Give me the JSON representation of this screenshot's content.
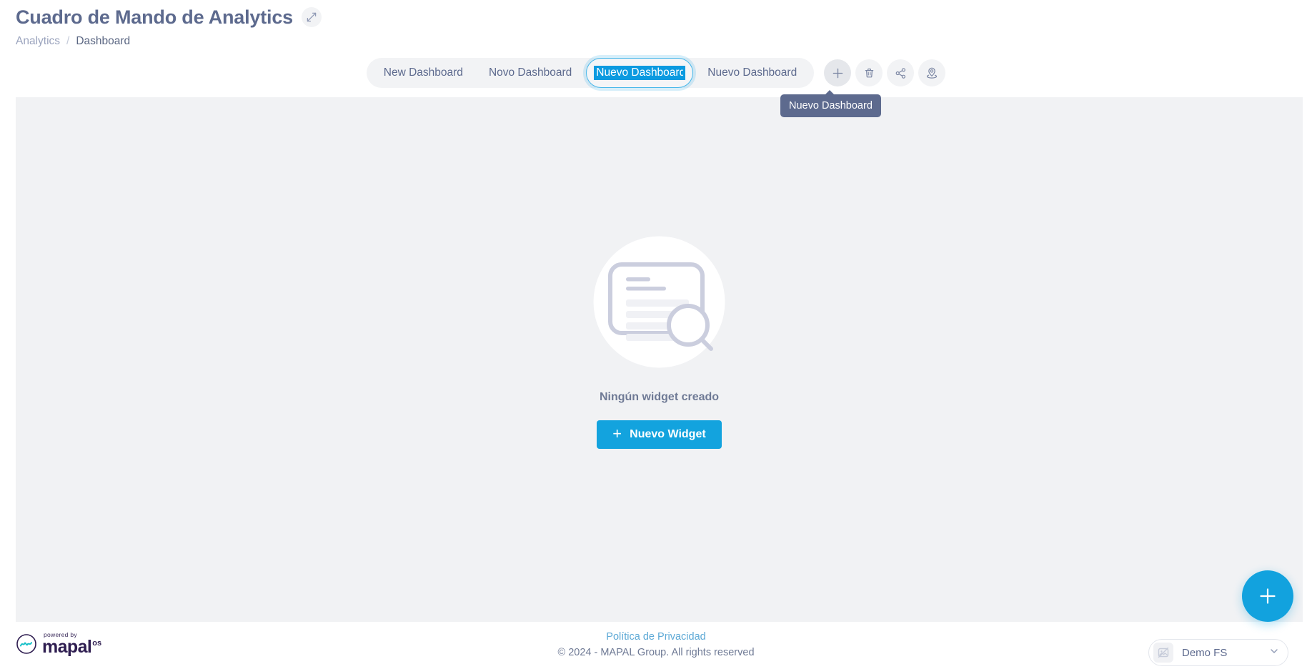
{
  "header": {
    "title": "Cuadro de Mando de Analytics",
    "expand_icon": "expand-arrows-icon",
    "breadcrumb": {
      "parent": "Analytics",
      "separator": "/",
      "current": "Dashboard"
    }
  },
  "tabs": {
    "items": [
      {
        "label": "New Dashboard",
        "state": "idle"
      },
      {
        "label": "Novo Dashboard",
        "state": "idle"
      },
      {
        "label": "Nuevo Dashboard",
        "state": "editing-selected"
      },
      {
        "label": "Nuevo Dashboard",
        "state": "idle"
      }
    ],
    "editing_value": "Nuevo Dashboard",
    "editing_placeholder": "Nuevo Dashboard",
    "actions": [
      {
        "name": "add-dashboard-button",
        "icon": "plus-icon",
        "hovered": true
      },
      {
        "name": "delete-dashboard-button",
        "icon": "trash-icon",
        "hovered": false
      },
      {
        "name": "share-dashboard-button",
        "icon": "share-nodes-icon",
        "hovered": false
      },
      {
        "name": "locate-dashboard-button",
        "icon": "location-pin-icon",
        "hovered": false
      }
    ],
    "tooltip": "Nuevo Dashboard"
  },
  "empty_state": {
    "illustration": "document-search-illustration",
    "message": "Ningún widget creado",
    "cta_label": "Nuevo Widget",
    "cta_icon": "plus-icon"
  },
  "fab": {
    "icon": "plus-icon",
    "label": ""
  },
  "footer": {
    "brand": {
      "powered_by": "powered by",
      "wordmark": "mapal",
      "suffix": "os",
      "mark_icon": "mapal-wave-icon"
    },
    "privacy_link": "Política de Privacidad",
    "copyright": "© 2024 - MAPAL Group. All rights reserved"
  },
  "org_selector": {
    "name": "Demo FS",
    "avatar_icon": "image-placeholder-icon",
    "chevron_icon": "chevron-down-icon"
  },
  "colors": {
    "accent": "#12a2de",
    "selection": "#0b9ae0",
    "slate": "#5d6a8e",
    "panel_bg": "#f1f2f4",
    "tooltip_bg": "#5d6a8e",
    "link": "#5da9d6"
  }
}
